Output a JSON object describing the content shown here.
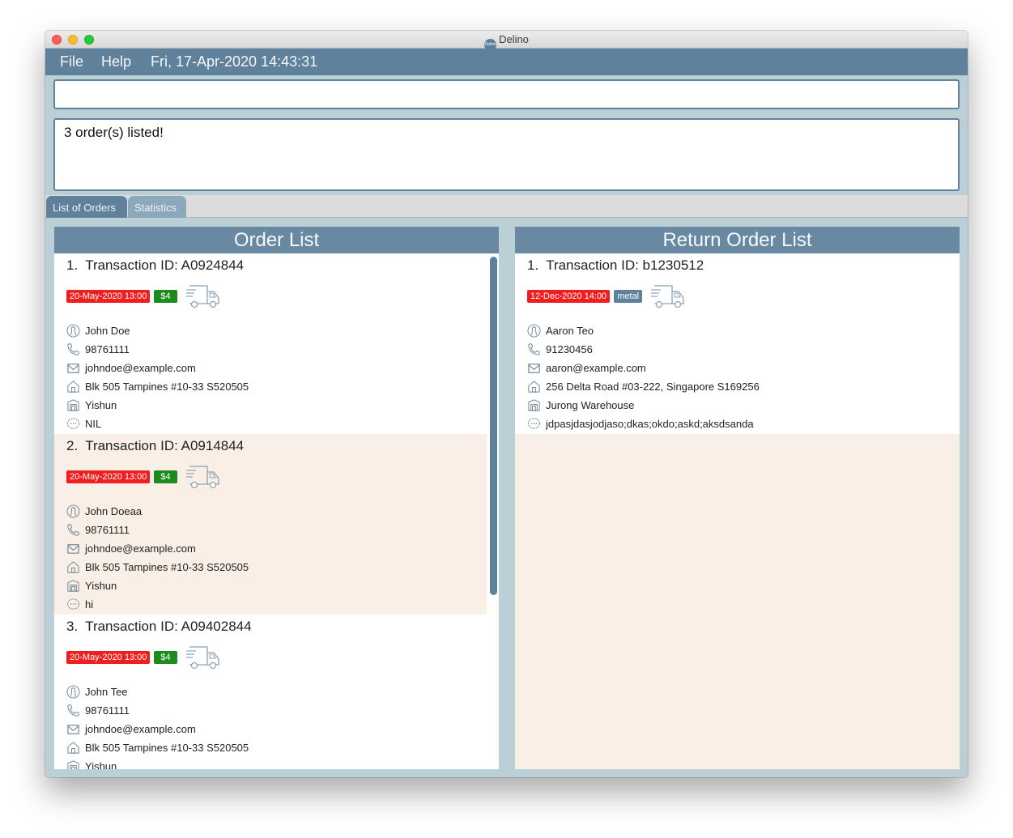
{
  "window": {
    "title": "Delino",
    "logo_text": "Delino"
  },
  "menubar": {
    "file_label": "File",
    "help_label": "Help",
    "clock": "Fri, 17-Apr-2020 14:43:31"
  },
  "command_box": {
    "value": "",
    "placeholder": ""
  },
  "result_display": {
    "text": "3 order(s) listed!"
  },
  "tabs": [
    {
      "label": "List of Orders",
      "active": true
    },
    {
      "label": "Statistics",
      "active": false
    }
  ],
  "order_list": {
    "title": "Order List",
    "orders": [
      {
        "index": "1.",
        "transaction_id": "Transaction ID: A0924844",
        "delivery_time": "20-May-2020 13:00",
        "price": "$4",
        "name": "John Doe",
        "phone": "98761111",
        "email": "johndoe@example.com",
        "address": "Blk 505 Tampines #10-33 S520505",
        "warehouse": "Yishun",
        "comment": "NIL"
      },
      {
        "index": "2.",
        "transaction_id": "Transaction ID: A0914844",
        "delivery_time": "20-May-2020 13:00",
        "price": "$4",
        "name": "John Doeaa",
        "phone": "98761111",
        "email": "johndoe@example.com",
        "address": "Blk 505 Tampines #10-33 S520505",
        "warehouse": "Yishun",
        "comment": "hi"
      },
      {
        "index": "3.",
        "transaction_id": "Transaction ID: A09402844",
        "delivery_time": "20-May-2020 13:00",
        "price": "$4",
        "name": "John Tee",
        "phone": "98761111",
        "email": "johndoe@example.com",
        "address": "Blk 505 Tampines #10-33 S520505",
        "warehouse": "Yishun",
        "comment": ""
      }
    ]
  },
  "return_order_list": {
    "title": "Return Order List",
    "orders": [
      {
        "index": "1.",
        "transaction_id": "Transaction ID: b1230512",
        "return_time": "12-Dec-2020 14:00",
        "item_type": "metal",
        "name": "Aaron Teo",
        "phone": "91230456",
        "email": "aaron@example.com",
        "address": "256 Delta Road #03-222, Singapore S169256",
        "warehouse": "Jurong Warehouse",
        "comment": "jdpasjdasjodjaso;dkas;okdo;askd;aksdsanda"
      }
    ]
  },
  "colors": {
    "primary": "#5f819b",
    "background": "#bbcfd6",
    "alt_row": "#f9efe6",
    "date_badge": "#f01f1f",
    "price_badge": "#1c8a1c"
  }
}
